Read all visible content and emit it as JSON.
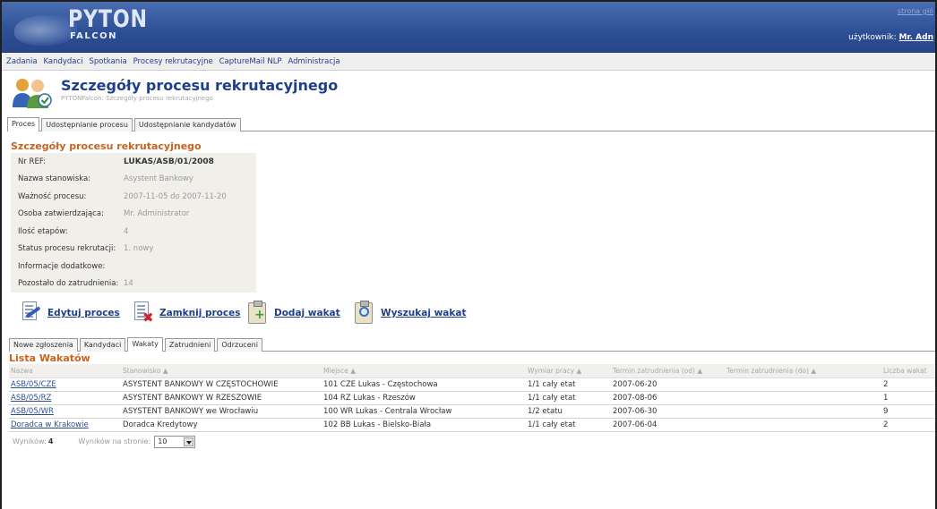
{
  "header": {
    "logo_title": "PYTON",
    "logo_sub": "FALCON",
    "top_link": "strona głó",
    "user_prefix": "użytkownik:",
    "user_name": "Mr. Adn"
  },
  "menu": [
    "Zadania",
    "Kandydaci",
    "Spotkania",
    "Procesy rekrutacyjne",
    "CaptureMail NLP",
    "Administracja"
  ],
  "page": {
    "title": "Szczegóły procesu rekrutacyjnego",
    "breadcrumb": "PYTONFalcon: Szczegóły procesu rekrutacyjnego"
  },
  "tabs": [
    "Proces",
    "Udostępnianie procesu",
    "Udostępnianie kandydatów"
  ],
  "details": {
    "title": "Szczegóły procesu rekrutacyjnego",
    "rows": [
      {
        "label": "Nr REF:",
        "value": "LUKAS/ASB/01/2008"
      },
      {
        "label": "Nazwa stanowiska:",
        "value": "Asystent Bankowy"
      },
      {
        "label": "Ważność procesu:",
        "value": "2007-11-05 do 2007-11-20"
      },
      {
        "label": "Osoba zatwierdzająca:",
        "value": "Mr. Administrator"
      },
      {
        "label": "Ilość etapów:",
        "value": "4"
      },
      {
        "label": "Status procesu rekrutacji:",
        "value": "1. nowy"
      },
      {
        "label": "Informacje dodatkowe:",
        "value": ""
      },
      {
        "label": "Pozostało do zatrudnienia:",
        "value": "14"
      }
    ]
  },
  "actions": {
    "edit": "Edytuj proces",
    "close": "Zamknij proces",
    "add": "Dodaj wakat",
    "search": "Wyszukaj wakat"
  },
  "subtabs": [
    "Nowe zgłoszenia",
    "Kandydaci",
    "Wakaty",
    "Zatrudnieni",
    "Odrzuceni"
  ],
  "list": {
    "title": "Lista Wakatów",
    "columns": [
      "Nazwa",
      "Stanowisko ▲",
      "Miejsce ▲",
      "Wymiar pracy ▲",
      "Termin zatrudnienia (od) ▲",
      "Termin zatrudnienia (do) ▲",
      "Liczba wakat"
    ],
    "rows": [
      [
        "ASB/05/CZE",
        "ASYSTENT BANKOWY W CZĘSTOCHOWIE",
        "101 CZE Lukas - Częstochowa",
        "1/1 cały etat",
        "2007-06-20",
        "",
        "2"
      ],
      [
        "ASB/05/RZ",
        "ASYSTENT BANKOWY W RZESZOWIE",
        "104 RZ Lukas - Rzeszów",
        "1/1 cały etat",
        "2007-08-06",
        "",
        "1"
      ],
      [
        "ASB/05/WR",
        "ASYSTENT BANKOWY we Wrocławiu",
        "100 WR Lukas - Centrala Wrocław",
        "1/2 etatu",
        "2007-06-30",
        "",
        "9"
      ],
      [
        "Doradca w Krakowie",
        "Doradca Kredytowy",
        "102 BB Lukas - Bielsko-Biała",
        "1/1 cały etat",
        "2007-06-04",
        "",
        "2"
      ]
    ]
  },
  "footer": {
    "results_label": "Wyników:",
    "results_count": "4",
    "per_page_label": "Wyników na stronie:",
    "per_page_value": "10"
  }
}
